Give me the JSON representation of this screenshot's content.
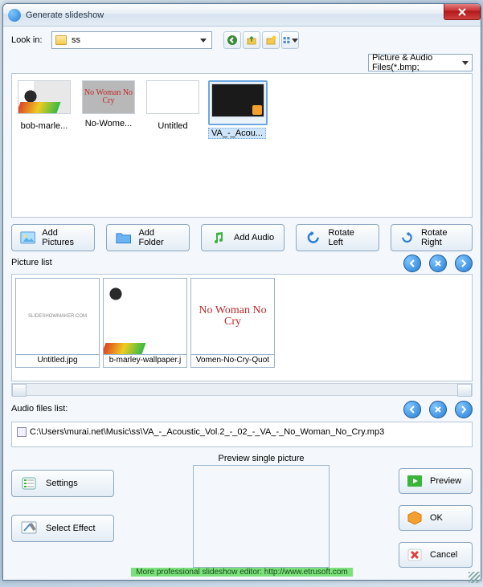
{
  "window": {
    "title": "Generate slideshow"
  },
  "lookin": {
    "label": "Look in:",
    "value": "ss"
  },
  "filter": {
    "value": "Picture & Audio Files(*.bmp;"
  },
  "browser_items": [
    {
      "name": "bob-marle..."
    },
    {
      "name": "No-Wome..."
    },
    {
      "name": "Untitled"
    },
    {
      "name": "VA_-_Acou..."
    }
  ],
  "actions": {
    "add_pictures": "Add Pictures",
    "add_folder": "Add Folder",
    "add_audio": "Add Audio",
    "rotate_left": "Rotate Left",
    "rotate_right": "Rotate Right"
  },
  "picture_list": {
    "label": "Picture list",
    "items": [
      {
        "name": "Untitled.jpg"
      },
      {
        "name": "b-marley-wallpaper.j"
      },
      {
        "name": "Vomen-No-Cry-Quot"
      }
    ]
  },
  "audio_list": {
    "label": "Audio files list:",
    "items": [
      {
        "path": "C:\\Users\\murai.net\\Music\\ss\\VA_-_Acoustic_Vol.2_-_02_-_VA_-_No_Woman_No_Cry.mp3"
      }
    ]
  },
  "preview": {
    "label": "Preview single picture"
  },
  "left_buttons": {
    "settings": "Settings",
    "select_effect": "Select Effect"
  },
  "right_buttons": {
    "preview": "Preview",
    "ok": "OK",
    "cancel": "Cancel"
  },
  "footer": {
    "text": "More professional slideshow editor: http://www.etrusoft.com"
  },
  "thumb_text": {
    "nowoman": "No Woman\nNo Cry",
    "untitled_small": "SLIDESHOWMAKER.COM"
  }
}
